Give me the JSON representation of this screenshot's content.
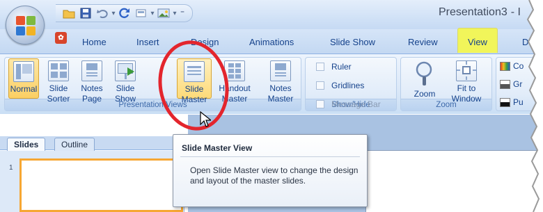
{
  "window": {
    "title": "Presentation3",
    "title_suffix": "- I"
  },
  "qat": {
    "icons": [
      "open-folder-icon",
      "save-icon",
      "undo-icon",
      "undo-dropdown-icon",
      "redo-icon",
      "new-slide-icon",
      "new-slide-dropdown-icon",
      "picture-icon",
      "picture-dropdown-icon",
      "customize-qat-icon"
    ]
  },
  "tabs": [
    {
      "label": "Home"
    },
    {
      "label": "Insert"
    },
    {
      "label": "Design"
    },
    {
      "label": "Animations"
    },
    {
      "label": "Slide Show"
    },
    {
      "label": "Review"
    },
    {
      "label": "View"
    },
    {
      "label": "De"
    }
  ],
  "ribbon": {
    "presentation_views": {
      "label": "Presentation Views",
      "buttons": [
        {
          "line1": "Normal",
          "line2": ""
        },
        {
          "line1": "Slide",
          "line2": "Sorter"
        },
        {
          "line1": "Notes",
          "line2": "Page"
        },
        {
          "line1": "Slide",
          "line2": "Show"
        },
        {
          "line1": "Slide",
          "line2": "Master"
        },
        {
          "line1": "Handout",
          "line2": "Master"
        },
        {
          "line1": "Notes",
          "line2": "Master"
        }
      ]
    },
    "show_hide": {
      "label": "Show/Hide",
      "items": [
        {
          "label": "Ruler"
        },
        {
          "label": "Gridlines"
        },
        {
          "label": "Message Bar"
        }
      ]
    },
    "zoom": {
      "label": "Zoom",
      "zoom_label": "Zoom",
      "fit_line1": "Fit to",
      "fit_line2": "Window"
    },
    "color": {
      "items": [
        {
          "label": "Co",
          "color": "#e04020"
        },
        {
          "label": "Gr",
          "color": "#555555"
        },
        {
          "label": "Pu",
          "color": "#111111"
        }
      ]
    }
  },
  "pane": {
    "tabs": [
      "Slides",
      "Outline"
    ],
    "slide_number": "1"
  },
  "tooltip": {
    "title": "Slide Master View",
    "body": "Open Slide Master view to change the design and layout of the master slides."
  },
  "colors": {
    "annotation": "#e3252d",
    "tab_highlight": "#f1f55a",
    "ribbon_text": "#15428b"
  }
}
